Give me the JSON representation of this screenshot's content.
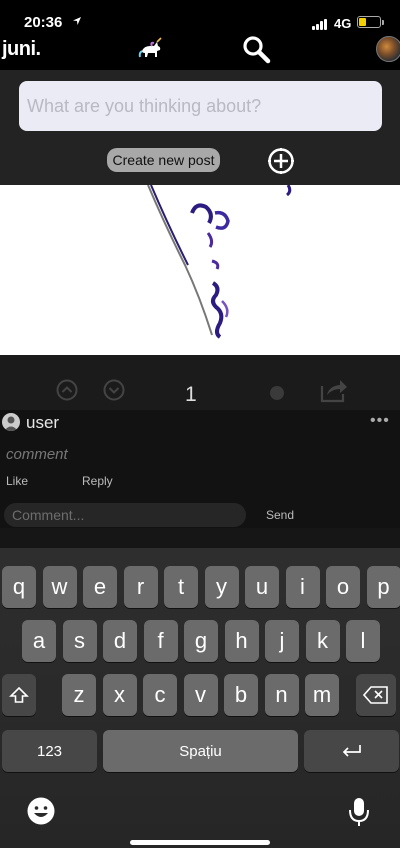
{
  "status_bar": {
    "time": "20:36",
    "location_icon": "location-arrow-icon",
    "network": "4G",
    "battery_color": "#f5d000",
    "battery_level": 0.35
  },
  "header": {
    "logo": "juni.",
    "icons": [
      "unicorn-icon",
      "search-icon",
      "avatar"
    ]
  },
  "composer": {
    "placeholder": "What are you thinking about?",
    "create_button": "Create new post",
    "add_icon": "add-photo-icon"
  },
  "post": {
    "actions": {
      "upvote_icon": "chevron-up-icon",
      "downvote_icon": "chevron-down-icon",
      "vote_count": "1",
      "share_icon": "share-icon"
    }
  },
  "comment": {
    "user": "user",
    "text": "comment",
    "like_label": "Like",
    "reply_label": "Reply",
    "more": "•••",
    "input_placeholder": "Comment...",
    "send_label": "Send"
  },
  "keyboard": {
    "row1": [
      "q",
      "w",
      "e",
      "r",
      "t",
      "y",
      "u",
      "i",
      "o",
      "p"
    ],
    "row2": [
      "a",
      "s",
      "d",
      "f",
      "g",
      "h",
      "j",
      "k",
      "l"
    ],
    "row3": [
      "z",
      "x",
      "c",
      "v",
      "b",
      "n",
      "m"
    ],
    "numbers_label": "123",
    "space_label": "Spațiu",
    "icons": [
      "shift-icon",
      "backspace-icon",
      "return-icon",
      "emoji-icon",
      "microphone-icon"
    ]
  },
  "colors": {
    "background": "#000000",
    "composer_bg": "#232323",
    "input_bg": "#ebebf5",
    "button_bg": "#a8a8a8",
    "ink": "#4b2a9e"
  }
}
